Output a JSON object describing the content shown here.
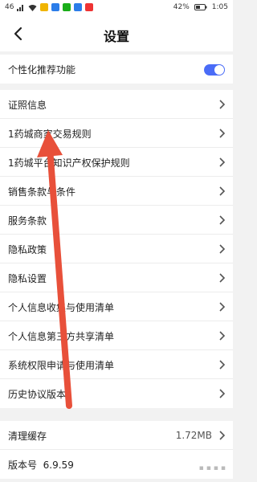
{
  "status": {
    "network": "46",
    "battery": "42%",
    "time": "1:05"
  },
  "nav": {
    "title": "设置",
    "back_icon": "chevron-left-icon"
  },
  "personalization": {
    "label": "个性化推荐功能",
    "enabled": true,
    "toggle_color": "#4a6cf7"
  },
  "menu": [
    {
      "label": "证照信息"
    },
    {
      "label": "1药城商家交易规则"
    },
    {
      "label": "1药城平台知识产权保护规则"
    },
    {
      "label": "销售条款与条件"
    },
    {
      "label": "服务条款"
    },
    {
      "label": "隐私政策"
    },
    {
      "label": "隐私设置"
    },
    {
      "label": "个人信息收集与使用清单"
    },
    {
      "label": "个人信息第三方共享清单"
    },
    {
      "label": "系统权限申请与使用清单"
    },
    {
      "label": "历史协议版本"
    }
  ],
  "cache": {
    "label": "清理缓存",
    "value": "1.72MB"
  },
  "version": {
    "label": "版本号",
    "value": "6.9.59"
  },
  "annotation": {
    "arrow_color": "#e8503a"
  }
}
